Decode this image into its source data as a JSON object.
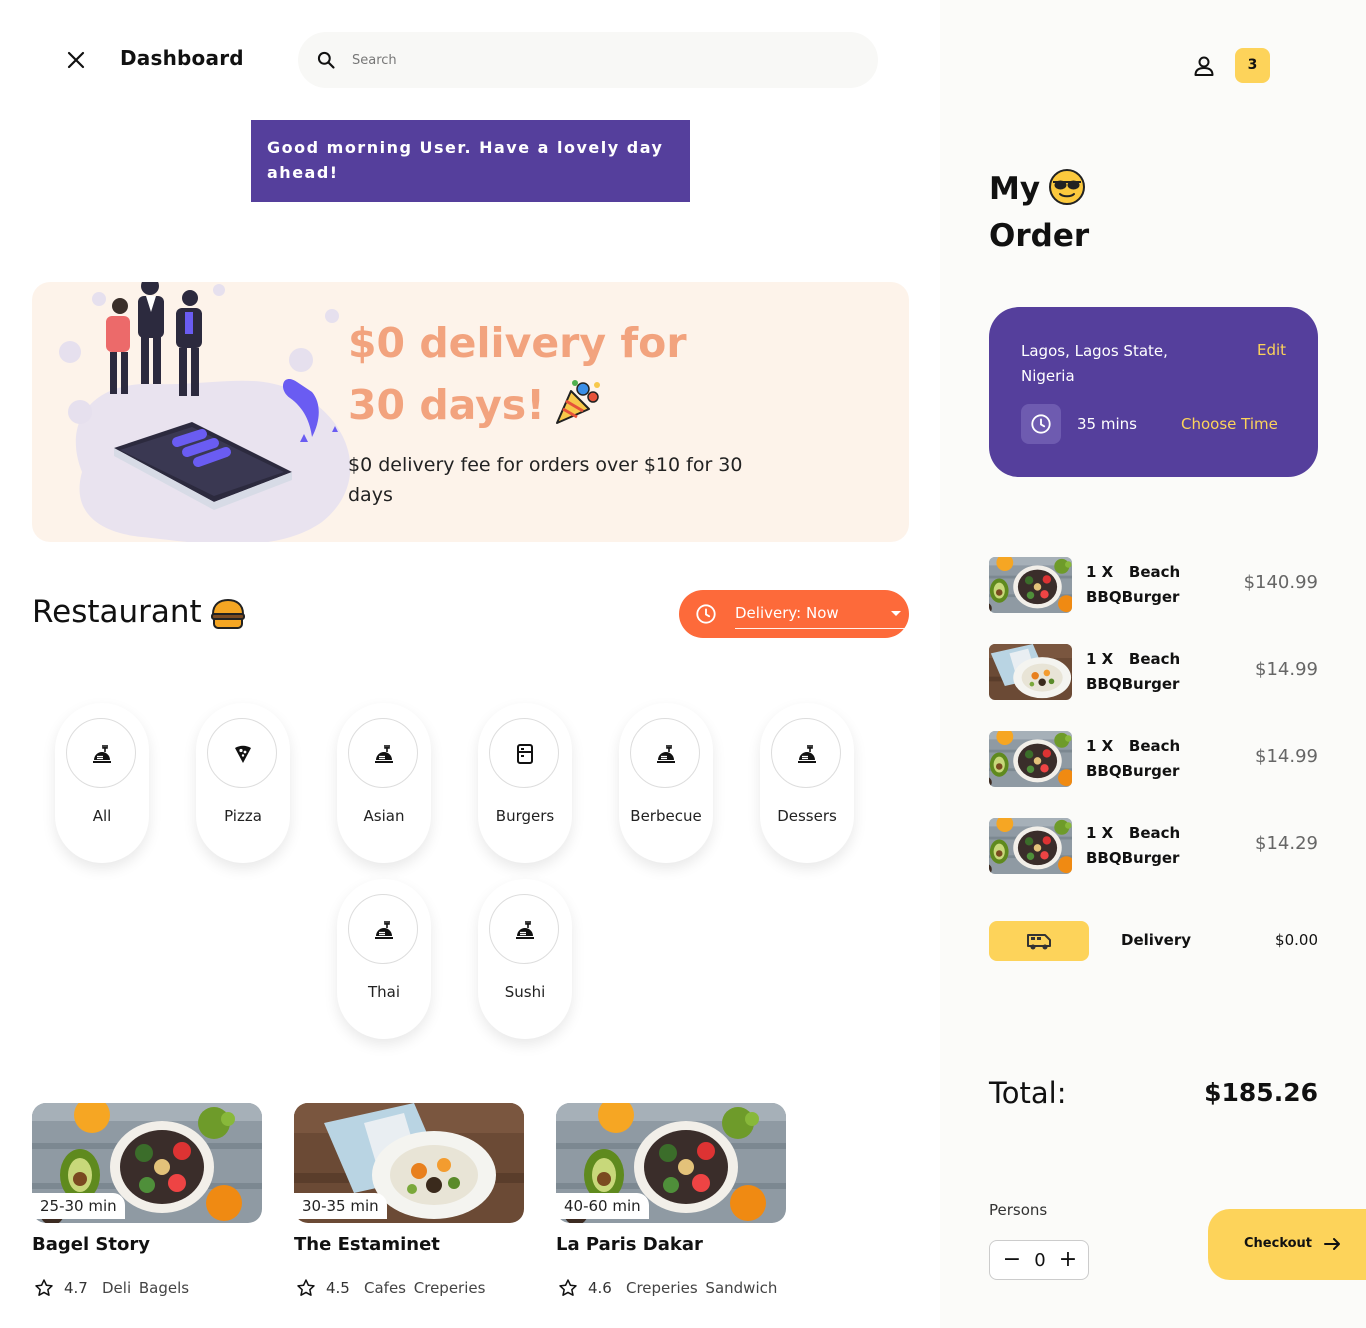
{
  "header": {
    "title": "Dashboard",
    "search_placeholder": "Search"
  },
  "greeting": "Good morning User. Have a lovely day ahead!",
  "promo": {
    "title": "$0 delivery for 30 days!",
    "subtitle": "$0 delivery fee for orders over $10 for 30 days",
    "title_color": "#f2a37e"
  },
  "restaurants_section": {
    "title": "Restaurant",
    "delivery_select": "Delivery: Now",
    "accent": "#fd6a3a"
  },
  "categories": [
    {
      "label": "All",
      "icon": "food-dish-icon"
    },
    {
      "label": "Pizza",
      "icon": "pizza-icon"
    },
    {
      "label": "Asian",
      "icon": "food-dish-icon"
    },
    {
      "label": "Burgers",
      "icon": "menu-box-icon"
    },
    {
      "label": "Berbecue",
      "icon": "food-dish-icon"
    },
    {
      "label": "Dessers",
      "icon": "food-dish-icon"
    },
    {
      "label": "Thai",
      "icon": "food-dish-icon"
    },
    {
      "label": "Sushi",
      "icon": "food-dish-icon"
    }
  ],
  "restaurants": [
    {
      "time": "25-30 min",
      "name": "Bagel Story",
      "rating": "4.7",
      "tags": "Deli  Bagels"
    },
    {
      "time": "30-35 min",
      "name": "The Estaminet",
      "rating": "4.5",
      "tags": "Cafes  Creperies"
    },
    {
      "time": "40-60 min",
      "name": "La Paris Dakar",
      "rating": "4.6",
      "tags": "Creperies  Sandwich"
    }
  ],
  "sidebar": {
    "cart_count": "3",
    "title_line1": "My",
    "title_line2": "Order",
    "address": "Lagos, Lagos State, Nigeria",
    "edit_label": "Edit",
    "delivery_time": "35 mins",
    "choose_time_label": "Choose Time",
    "brand_color": "#553f9c",
    "highlight_color": "#fdd35a"
  },
  "order_items": [
    {
      "qty": "1 X",
      "name_line1": "Beach",
      "name_line2": "BBQBurger",
      "price": "$140.99"
    },
    {
      "qty": "1 X",
      "name_line1": "Beach",
      "name_line2": "BBQBurger",
      "price": "$14.99"
    },
    {
      "qty": "1 X",
      "name_line1": "Beach",
      "name_line2": "BBQBurger",
      "price": "$14.99"
    },
    {
      "qty": "1 X",
      "name_line1": "Beach",
      "name_line2": "BBQBurger",
      "price": "$14.29"
    }
  ],
  "delivery": {
    "label": "Delivery",
    "value": "$0.00"
  },
  "total": {
    "label": "Total:",
    "value": "$185.26"
  },
  "persons": {
    "label": "Persons",
    "value": "0"
  },
  "checkout_label": "Checkout"
}
